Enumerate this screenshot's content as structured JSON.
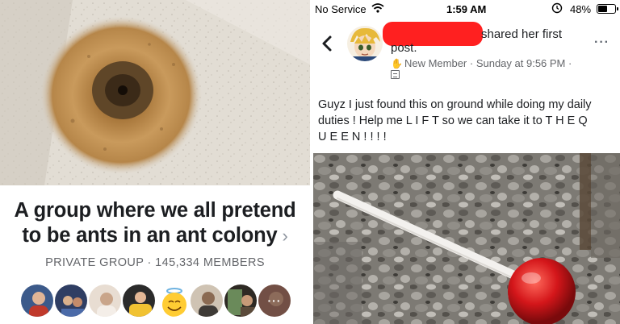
{
  "left": {
    "title_line1": "A group where we all pretend",
    "title_line2": "to be ants in an ant colony",
    "chevron": "›",
    "meta": "PRIVATE GROUP · 145,334 MEMBERS",
    "member_avatars": [
      {
        "name": "member-avatar-1",
        "color": "#c9a38a"
      },
      {
        "name": "member-avatar-2",
        "color": "#2f3e63"
      },
      {
        "name": "member-avatar-3",
        "color": "#d9c6b8"
      },
      {
        "name": "member-avatar-4",
        "color": "#f1c232"
      },
      {
        "name": "member-avatar-5",
        "color": "#ffcc33"
      },
      {
        "name": "member-avatar-6",
        "color": "#7a6a58"
      },
      {
        "name": "member-avatar-7",
        "color": "#5b4a3a"
      },
      {
        "name": "member-avatar-8",
        "color": "#b07a6a"
      }
    ],
    "more_members_label": "···"
  },
  "status_bar": {
    "carrier": "No Service",
    "time": "1:59 AM",
    "battery": "48%",
    "battery_level": 0.48
  },
  "post": {
    "action_part1": "shared her first",
    "action_part2": "post.",
    "badge": "New Member",
    "timestamp": "· Sunday at 9:56 PM ·",
    "more": "···",
    "text": "Guyz I just found this on ground while doing my daily\nduties ! Help me L I F T so we can take it to T H E   Q\nU E E N ! ! ! !"
  },
  "colors": {
    "redaction": "#ff2020",
    "sand": "#c79a5c",
    "gravel": "#8c8c88",
    "candy": "#d4161a"
  },
  "icons": {
    "back": "back-chevron-icon",
    "wifi": "wifi-icon",
    "alarm": "alarm-icon",
    "battery": "battery-icon",
    "badge": "new-member-badge-icon",
    "privacy": "group-privacy-icon",
    "more": "more-options-icon"
  }
}
